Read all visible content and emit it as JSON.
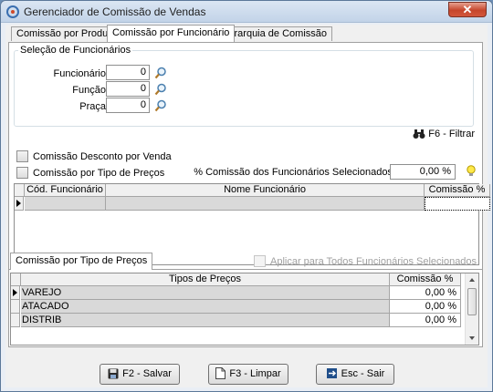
{
  "window": {
    "title": "Gerenciador de Comissão de Vendas",
    "close": "✕"
  },
  "tabs": [
    "Comissão por Produto",
    "Comissão por Funcionário",
    "Hierarquia de Comissão"
  ],
  "selection": {
    "group_label": "Seleção de Funcionários",
    "fields": [
      {
        "label": "Funcionário",
        "value": "0"
      },
      {
        "label": "Função",
        "value": "0"
      },
      {
        "label": "Praça",
        "value": "0"
      }
    ],
    "filter_label": "F6 - Filtrar"
  },
  "options": {
    "desconto_label": "Comissão Desconto por Venda",
    "tipo_precos_label": "Comissão por Tipo de Preços",
    "percent_label": "% Comissão dos Funcionários Selecionados:",
    "percent_value": "0,00 %"
  },
  "employees_grid": {
    "columns": [
      "Cód. Funcionário",
      "Nome Funcionário",
      "Comissão %"
    ]
  },
  "price_types": {
    "tab_label": "Comissão por Tipo de Preços",
    "apply_all_label": "Aplicar para Todos Funcionários Selecionados",
    "columns": [
      "Tipos de Preços",
      "Comissão %"
    ],
    "rows": [
      {
        "name": "VAREJO",
        "value": "0,00 %"
      },
      {
        "name": "ATACADO",
        "value": "0,00 %"
      },
      {
        "name": "DISTRIB",
        "value": "0,00 %"
      }
    ]
  },
  "buttons": {
    "save": "F2 - Salvar",
    "clear": "F3 - Limpar",
    "exit": "Esc - Sair"
  }
}
